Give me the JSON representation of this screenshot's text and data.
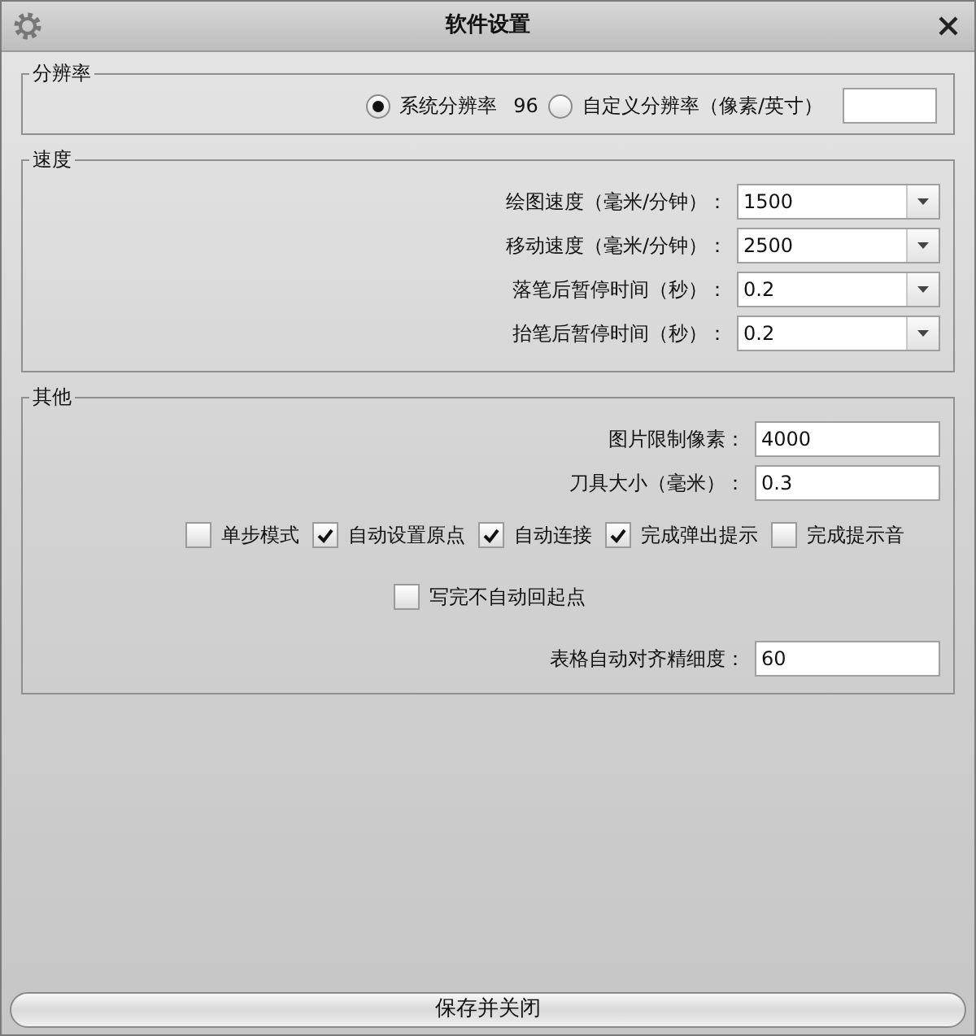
{
  "window": {
    "title": "软件设置"
  },
  "resolution": {
    "legend": "分辨率",
    "options": [
      {
        "label": "系统分辨率",
        "selected": true,
        "value": "96"
      },
      {
        "label": "自定义分辨率（像素/英寸）",
        "selected": false
      }
    ]
  },
  "speed": {
    "legend": "速度",
    "fields": [
      {
        "label": "绘图速度（毫米/分钟）：",
        "value": "1500"
      },
      {
        "label": "移动速度（毫米/分钟）：",
        "value": "2500"
      },
      {
        "label": "落笔后暂停时间（秒）：",
        "value": "0.2"
      },
      {
        "label": "抬笔后暂停时间（秒）：",
        "value": "0.2"
      }
    ]
  },
  "other": {
    "legend": "其他",
    "fields": [
      {
        "label": "图片限制像素：",
        "value": "4000"
      },
      {
        "label": "刀具大小（毫米）：",
        "value": "0.3"
      }
    ],
    "checkboxes": [
      {
        "label": "单步模式",
        "checked": false
      },
      {
        "label": "自动设置原点",
        "checked": true
      },
      {
        "label": "自动连接",
        "checked": true
      },
      {
        "label": "完成弹出提示",
        "checked": true
      },
      {
        "label": "完成提示音",
        "checked": false
      }
    ],
    "extra_checkbox": {
      "label": "写完不自动回起点",
      "checked": false
    },
    "last_field": {
      "label": "表格自动对齐精细度：",
      "value": "60"
    }
  },
  "save_button": "保存并关闭"
}
